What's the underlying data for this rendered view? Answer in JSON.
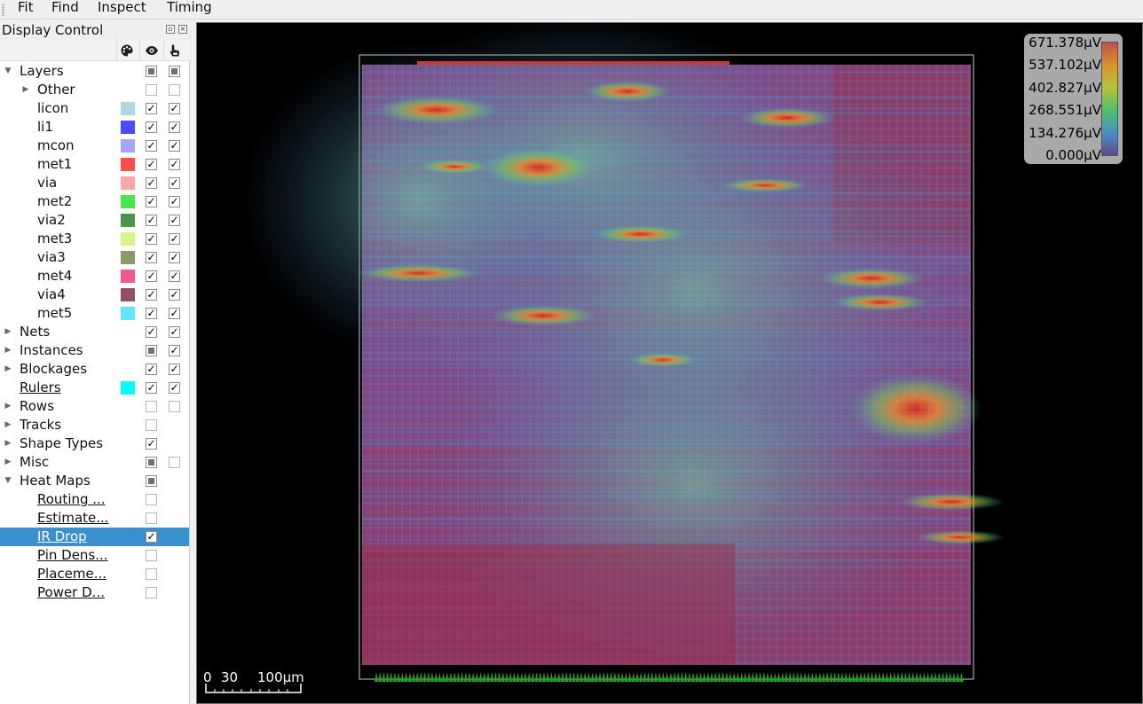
{
  "menubar": {
    "items": [
      {
        "label": "Fit"
      },
      {
        "label": "Find"
      },
      {
        "label": "Inspect"
      },
      {
        "label": "Timing"
      }
    ]
  },
  "display_control": {
    "title": "Display Control",
    "header_icons": [
      "palette-icon",
      "eye-icon",
      "pointer-hand-icon"
    ],
    "rows": [
      {
        "label": "Layers",
        "level": 0,
        "expander": "expanded",
        "color": null,
        "visible": "partial",
        "selectable": "partial"
      },
      {
        "label": "Other",
        "level": 1,
        "expander": "collapsed",
        "color": null,
        "visible": "empty",
        "selectable": "empty"
      },
      {
        "label": "licon",
        "level": 1,
        "expander": "",
        "color": "#add8e6",
        "visible": "checked",
        "selectable": "checked"
      },
      {
        "label": "li1",
        "level": 1,
        "expander": "",
        "color": "#4b4bff",
        "visible": "checked",
        "selectable": "checked"
      },
      {
        "label": "mcon",
        "level": 1,
        "expander": "",
        "color": "#a5a5ff",
        "visible": "checked",
        "selectable": "checked"
      },
      {
        "label": "met1",
        "level": 1,
        "expander": "",
        "color": "#ff4d4d",
        "visible": "checked",
        "selectable": "checked"
      },
      {
        "label": "via",
        "level": 1,
        "expander": "",
        "color": "#ffa5a5",
        "visible": "checked",
        "selectable": "checked"
      },
      {
        "label": "met2",
        "level": 1,
        "expander": "",
        "color": "#4be64b",
        "visible": "checked",
        "selectable": "checked"
      },
      {
        "label": "via2",
        "level": 1,
        "expander": "",
        "color": "#4b964b",
        "visible": "checked",
        "selectable": "checked"
      },
      {
        "label": "met3",
        "level": 1,
        "expander": "",
        "color": "#d7f58c",
        "visible": "checked",
        "selectable": "checked"
      },
      {
        "label": "via3",
        "level": 1,
        "expander": "",
        "color": "#8c9b64",
        "visible": "checked",
        "selectable": "checked"
      },
      {
        "label": "met4",
        "level": 1,
        "expander": "",
        "color": "#f05a91",
        "visible": "checked",
        "selectable": "checked"
      },
      {
        "label": "via4",
        "level": 1,
        "expander": "",
        "color": "#965064",
        "visible": "checked",
        "selectable": "checked"
      },
      {
        "label": "met5",
        "level": 1,
        "expander": "",
        "color": "#64e6ff",
        "visible": "checked",
        "selectable": "checked"
      },
      {
        "label": "Nets",
        "level": 0,
        "expander": "collapsed",
        "color": null,
        "visible": "checked",
        "selectable": "checked"
      },
      {
        "label": "Instances",
        "level": 0,
        "expander": "collapsed",
        "color": null,
        "visible": "partial",
        "selectable": "checked"
      },
      {
        "label": "Blockages",
        "level": 0,
        "expander": "collapsed",
        "color": null,
        "visible": "checked",
        "selectable": "checked"
      },
      {
        "label": "Rulers",
        "level": 0,
        "expander": "",
        "link": true,
        "color": "#00ffff",
        "visible": "checked",
        "selectable": "checked"
      },
      {
        "label": "Rows",
        "level": 0,
        "expander": "collapsed",
        "color": null,
        "visible": "empty",
        "selectable": "empty"
      },
      {
        "label": "Tracks",
        "level": 0,
        "expander": "collapsed",
        "color": null,
        "visible": "empty",
        "selectable": null
      },
      {
        "label": "Shape Types",
        "level": 0,
        "expander": "collapsed",
        "color": null,
        "visible": "checked",
        "selectable": null
      },
      {
        "label": "Misc",
        "level": 0,
        "expander": "collapsed",
        "color": null,
        "visible": "partial",
        "selectable": "empty"
      },
      {
        "label": "Heat Maps",
        "level": 0,
        "expander": "expanded",
        "color": null,
        "visible": "partial",
        "selectable": null
      },
      {
        "label": "Routing ...",
        "level": 1,
        "expander": "",
        "link": true,
        "color": null,
        "visible": "empty",
        "selectable": null
      },
      {
        "label": "Estimate...",
        "level": 1,
        "expander": "",
        "link": true,
        "color": null,
        "visible": "empty",
        "selectable": null
      },
      {
        "label": "IR Drop",
        "level": 1,
        "expander": "",
        "link": true,
        "selected": true,
        "color": null,
        "visible": "checked",
        "selectable": null
      },
      {
        "label": "Pin Dens...",
        "level": 1,
        "expander": "",
        "link": true,
        "color": null,
        "visible": "empty",
        "selectable": null
      },
      {
        "label": "Placeme...",
        "level": 1,
        "expander": "",
        "link": true,
        "color": null,
        "visible": "empty",
        "selectable": null
      },
      {
        "label": "Power D...",
        "level": 1,
        "expander": "",
        "link": true,
        "color": null,
        "visible": "empty",
        "selectable": null
      }
    ]
  },
  "legend": {
    "values": [
      "671.378µV",
      "537.102µV",
      "402.827µV",
      "268.551µV",
      "134.276µV",
      "0.000µV"
    ],
    "colors": [
      "#c0504d",
      "#d9932e",
      "#b7c23a",
      "#4fbf6a",
      "#4b8fc4",
      "#5c4b8c"
    ]
  },
  "scale_bar": {
    "label_0": "0",
    "label_1": "30",
    "label_2": "100µm"
  },
  "heatmap": {
    "background": "#8a3a6e",
    "grid_color": "#6bd3b0",
    "hotspot_color": "#e6552a",
    "pin_color": "#1fa51f"
  }
}
